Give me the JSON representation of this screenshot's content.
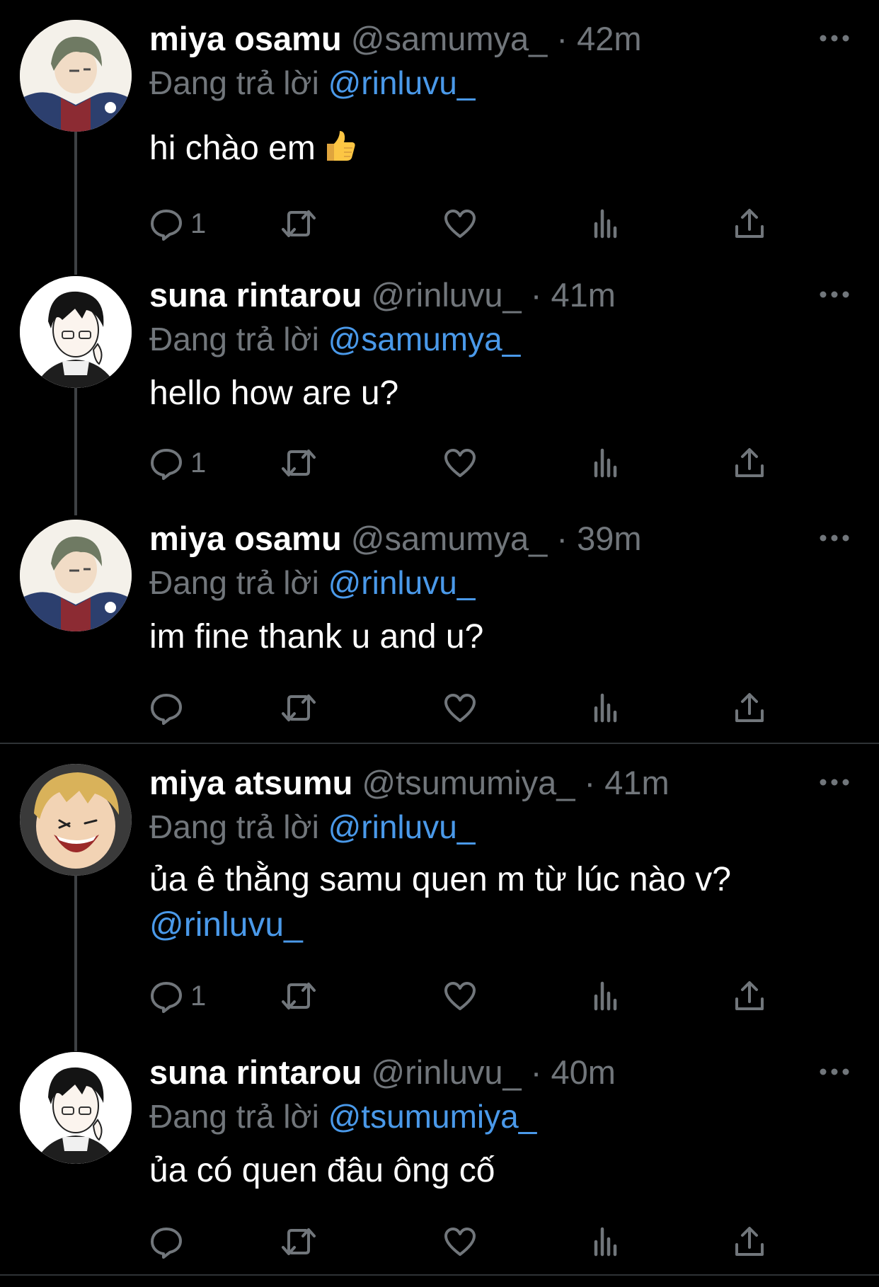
{
  "colors": {
    "background": "#000000",
    "primary_text": "#ffffff",
    "secondary_text": "#71767b",
    "accent": "#4a99e9",
    "thread_line": "#3e4144",
    "divider": "#2f3336"
  },
  "tweets": [
    {
      "name": "miya osamu",
      "handle": "@samumya_",
      "separator": "·",
      "time": "42m",
      "reply_prefix": "Đang trả lời",
      "reply_to": "@rinluvu_",
      "text": "hi chào em",
      "emoji": "thumbs-up",
      "reply_count": "1",
      "avatar": "osamu-avatar"
    },
    {
      "name": "suna rintarou",
      "handle": "@rinluvu_",
      "separator": "·",
      "time": "41m",
      "reply_prefix": "Đang trả lời",
      "reply_to": "@samumya_",
      "text": "hello how are u?",
      "reply_count": "1",
      "avatar": "suna-avatar"
    },
    {
      "name": "miya osamu",
      "handle": "@samumya_",
      "separator": "·",
      "time": "39m",
      "reply_prefix": "Đang trả lời",
      "reply_to": "@rinluvu_",
      "text": "im fine thank u and u?",
      "reply_count": "",
      "avatar": "osamu-avatar"
    },
    {
      "name": "miya atsumu",
      "handle": "@tsumumiya_",
      "separator": "·",
      "time": "41m",
      "reply_prefix": "Đang trả lời",
      "reply_to": "@rinluvu_",
      "text": "ủa ê thằng samu quen m từ lúc nào v?",
      "text_mention": "@rinluvu_",
      "reply_count": "1",
      "avatar": "atsumu-avatar"
    },
    {
      "name": "suna rintarou",
      "handle": "@rinluvu_",
      "separator": "·",
      "time": "40m",
      "reply_prefix": "Đang trả lời",
      "reply_to": "@tsumumiya_",
      "text": "ủa có quen đâu ông cố",
      "reply_count": "",
      "avatar": "suna-avatar"
    }
  ],
  "icons": {
    "more": "more-horizontal-icon",
    "reply": "reply-icon",
    "retweet": "retweet-icon",
    "like": "heart-icon",
    "views": "analytics-icon",
    "share": "share-icon"
  }
}
